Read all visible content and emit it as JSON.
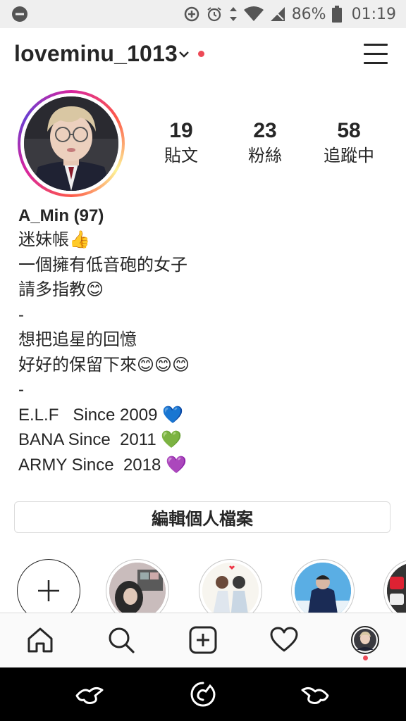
{
  "status_bar": {
    "battery": "86%",
    "time": "01:19"
  },
  "header": {
    "username": "loveminu_1013"
  },
  "stats": [
    {
      "value": "19",
      "label": "貼文"
    },
    {
      "value": "23",
      "label": "粉絲"
    },
    {
      "value": "58",
      "label": "追蹤中"
    }
  ],
  "bio": {
    "name": "A_Min (97)",
    "lines": [
      "迷妹帳👍",
      "一個擁有低音砲的女子",
      "請多指教😊",
      "-",
      "想把追星的回憶",
      "好好的保留下來😊😊😊",
      "-",
      "E.L.F   Since 2009 💙",
      "BANA Since  2011 💚",
      "ARMY Since  2018 💜"
    ]
  },
  "edit_profile_label": "編輯個人檔案",
  "colors": {
    "accent_red": "#ed4956",
    "text": "#262626",
    "border": "#dbdbdb"
  },
  "icons": {
    "status": [
      "do-not-disturb-icon",
      "data-saver-icon",
      "alarm-icon",
      "data-arrows-icon",
      "wifi-icon",
      "cellular-icon",
      "battery-icon"
    ],
    "nav": [
      "home-icon",
      "search-icon",
      "add-post-icon",
      "activity-heart-icon",
      "profile-avatar-icon"
    ],
    "system": [
      "back-icon",
      "home-system-icon",
      "recents-icon"
    ]
  }
}
